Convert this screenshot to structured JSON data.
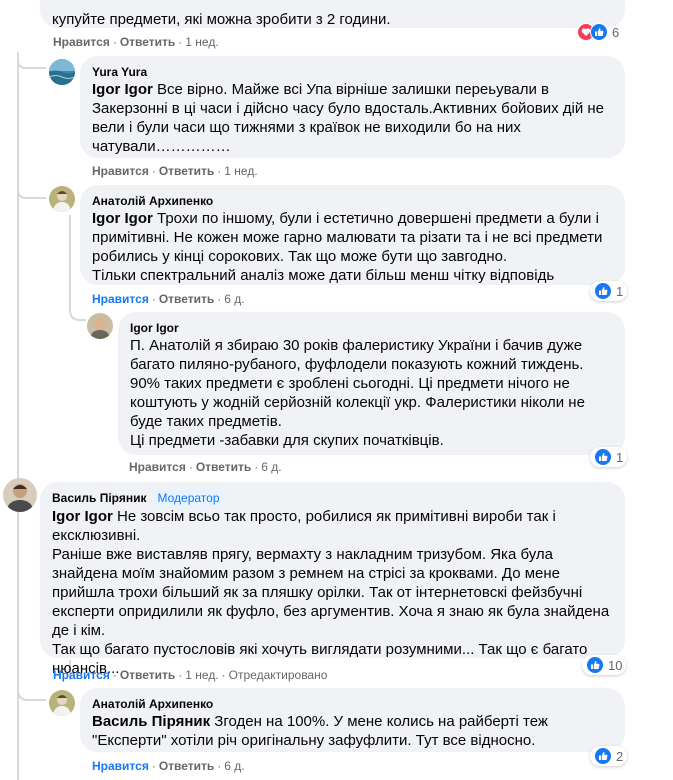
{
  "actions": {
    "like": "Нравится",
    "reply": "Ответить",
    "edited": "Отредактировано"
  },
  "top": {
    "text_tail": "купуйте предмети, які можна зробити з 2 години.",
    "time": "1 нед.",
    "reactions": "6"
  },
  "c1": {
    "author": "Yura Yura",
    "mention": "Igor Igor",
    "text": " Все вірно. Майже всі Упа вірніше залишки переьували в Закерзонні в ці часи і дійсно часу було вдосталь.Активних бойових дій не вели і були часи що тижнями з краївок не виходили бо на них чатували……………",
    "time": "1 нед."
  },
  "c2": {
    "author": "Анатолій Архипенко",
    "mention": "Igor Igor",
    "text": " Трохи по іншому, були і естетично довершені предмети а були і примітивні. Не кожен може гарно малювати та різати та і не всі предмети робились у кінці сорокових. Так що може бути що завгодно.\nТільки спектральний аналіз може дати більш менш чітку відповідь",
    "time": "6 д.",
    "reactions": "1"
  },
  "c3": {
    "author": "Igor Igor",
    "text": "П. Анатолій я збираю 30 років фалеристику України і бачив дуже багато пиляно-рубаного, фуфлодели показують кожний тиждень. 90% таких предмети є зроблені сьогодні. Ці предмети нічого не коштують у жодній серйозній колекції укр. Фалеристики ніколи не буде таких предметів.\nЦі предмети -забавки для скупих початківців.",
    "time": "6 д.",
    "reactions": "1"
  },
  "c4": {
    "author": "Василь Піряник",
    "badge": "Модератор",
    "mention": "Igor Igor",
    "text1": " Не зовсім всьо так просто, робилися як примітивні вироби так і ексклюзивні.",
    "text2": "Раніше вже виставляв прягу, вермахту з накладним тризубом. Яка була знайдена моїм знайомим разом з ремнем на стрісі за кроквами. До мене прийшла трохи більший як за пляшку орілки. Так от інтернетовскі фейзбучні експерти опридилили як фуфло, без аргументив. Хоча я знаю як була знайдена де і кім.\nТак що багато пустословів які хочуть виглядати розумними... Так що є багато нюансів...",
    "time": "1 нед.",
    "reactions": "10"
  },
  "c5": {
    "author": "Анатолій Архипенко",
    "mention": "Василь Піряник",
    "text": " Згоден на 100%. У мене колись на райберті теж \"Експерти\" хотіли річ оригінальну зафуфлити. Тут все відносно.",
    "time": "6 д.",
    "reactions": "2"
  },
  "icons": [
    "like-icon",
    "love-icon",
    "avatar-sea",
    "avatar-person"
  ],
  "colors": {
    "like": "#1877f2",
    "love": "#f33e58",
    "bubble": "#f0f2f5",
    "meta": "#65676b"
  }
}
